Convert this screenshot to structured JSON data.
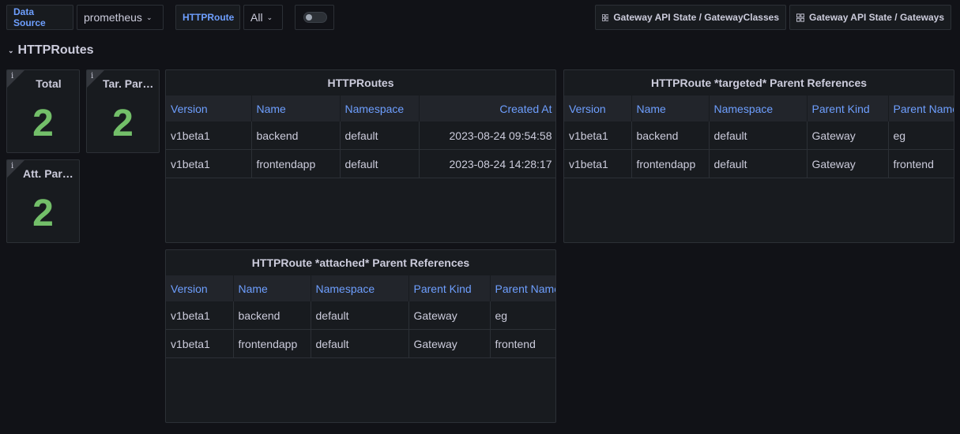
{
  "toolbar": {
    "datasource_label": "Data Source",
    "datasource_value": "prometheus",
    "httproute_label": "HTTPRoute",
    "httproute_value": "All",
    "links": [
      {
        "label": "Gateway API State / GatewayClasses",
        "icon": "apps-grid-icon"
      },
      {
        "label": "Gateway API State / Gateways",
        "icon": "apps-grid-icon"
      }
    ]
  },
  "row": {
    "title": "HTTPRoutes"
  },
  "stats": [
    {
      "title": "Total",
      "value": "2"
    },
    {
      "title": "Tar. Parent Refs",
      "value": "2"
    },
    {
      "title": "Att. Parent Refs",
      "value": "2"
    }
  ],
  "tables": {
    "routes": {
      "title": "HTTPRoutes",
      "headers": [
        "Version",
        "Name",
        "Namespace",
        "Created At"
      ],
      "rows": [
        [
          "v1beta1",
          "backend",
          "default",
          "2023-08-24 09:54:58"
        ],
        [
          "v1beta1",
          "frontendapp",
          "default",
          "2023-08-24 14:28:17"
        ]
      ]
    },
    "targeted": {
      "title": "HTTPRoute *targeted* Parent References",
      "headers": [
        "Version",
        "Name",
        "Namespace",
        "Parent Kind",
        "Parent Name"
      ],
      "rows": [
        [
          "v1beta1",
          "backend",
          "default",
          "Gateway",
          "eg"
        ],
        [
          "v1beta1",
          "frontendapp",
          "default",
          "Gateway",
          "frontend"
        ]
      ]
    },
    "attached": {
      "title": "HTTPRoute *attached* Parent References",
      "headers": [
        "Version",
        "Name",
        "Namespace",
        "Parent Kind",
        "Parent Name"
      ],
      "rows": [
        [
          "v1beta1",
          "backend",
          "default",
          "Gateway",
          "eg"
        ],
        [
          "v1beta1",
          "frontendapp",
          "default",
          "Gateway",
          "frontend"
        ]
      ]
    }
  },
  "colors": {
    "accent": "#6e9fff",
    "stat_value": "#73bf69",
    "background": "#111217",
    "panel": "#181b1f"
  }
}
